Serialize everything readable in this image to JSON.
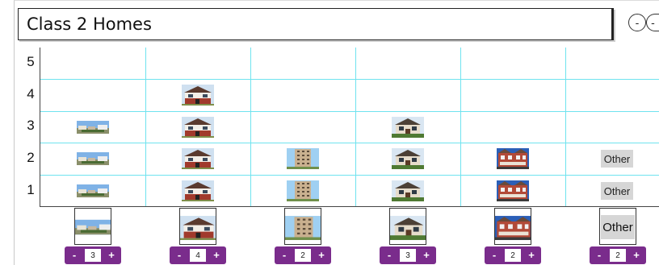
{
  "title": "Class 2 Homes",
  "zoom": {
    "out_label": "-",
    "in_label": "-"
  },
  "y_axis": {
    "labels": [
      "5",
      "4",
      "3",
      "2",
      "1"
    ]
  },
  "columns": [
    {
      "type": "house-wide",
      "count": "3"
    },
    {
      "type": "house-redbrick",
      "count": "4"
    },
    {
      "type": "tower",
      "count": "2"
    },
    {
      "type": "house-tudor",
      "count": "3"
    },
    {
      "type": "terrace",
      "count": "2"
    },
    {
      "type": "other",
      "count": "2",
      "label": "Other"
    }
  ],
  "stepper": {
    "minus": "-",
    "plus": "+"
  },
  "colors": {
    "grid": "#6fe3ef",
    "stepper": "#7a2c8c",
    "other_bg": "#d6d6d6"
  }
}
